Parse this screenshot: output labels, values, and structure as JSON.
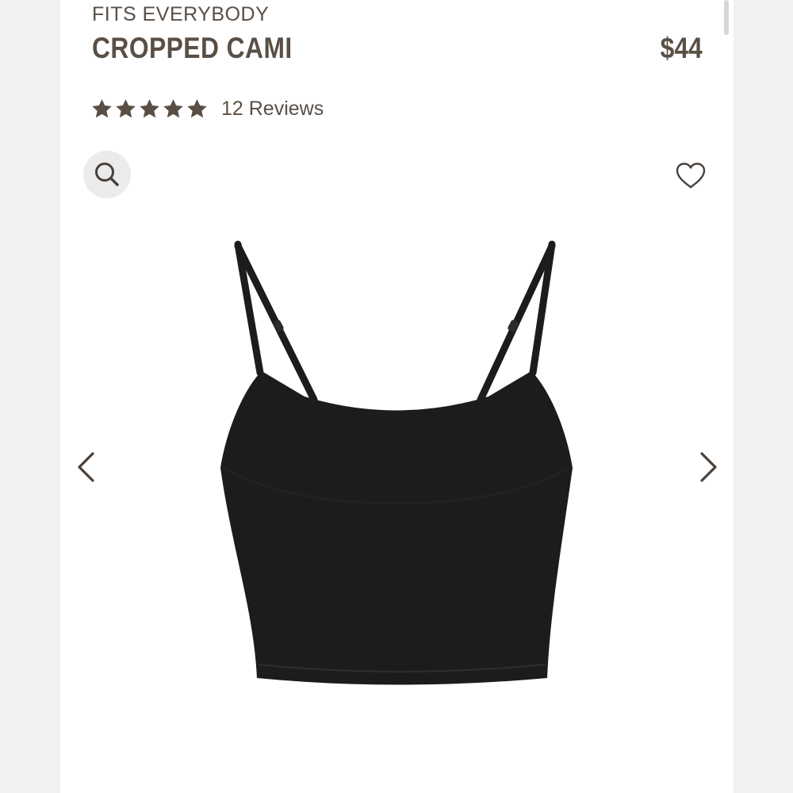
{
  "product": {
    "collection": "FITS EVERYBODY",
    "name": "CROPPED CAMI",
    "price": "$44",
    "rating": 5,
    "reviews_label": "12 Reviews"
  },
  "icons": {
    "zoom": "magnifier-icon",
    "favorite": "heart-icon",
    "previous": "chevron-left-icon",
    "next": "chevron-right-icon",
    "rating_star": "star-icon"
  },
  "colors": {
    "text": "#5a4f45",
    "garment": "#1c1c1c",
    "zoom_button_bg": "#ebebeb"
  }
}
